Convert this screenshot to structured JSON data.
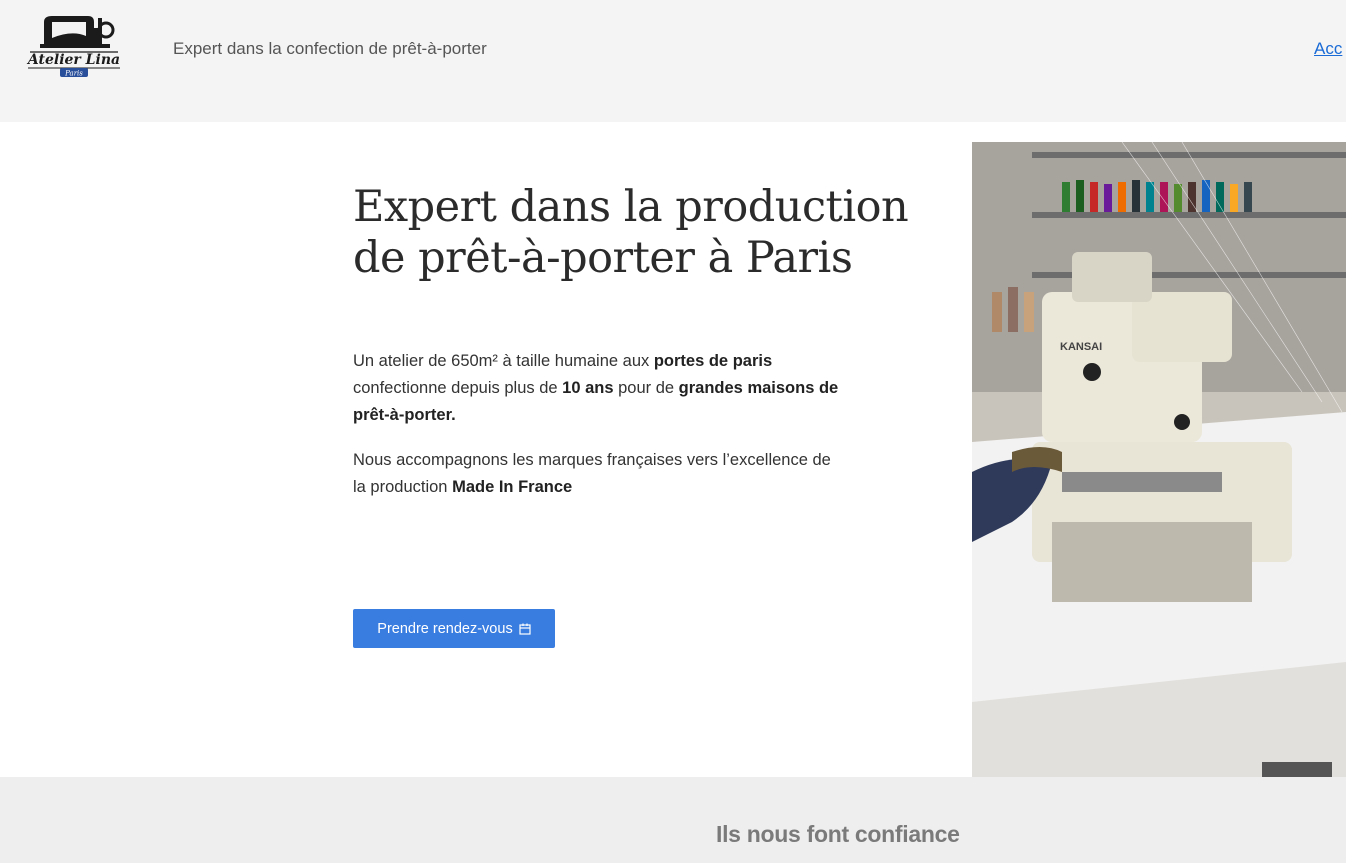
{
  "header": {
    "logo": {
      "brand": "Atelier Lina",
      "sub": "Paris"
    },
    "tagline": "Expert dans la confection de prêt-à-porter",
    "nav_link": "Acc"
  },
  "hero": {
    "title_line1": "Expert dans la production",
    "title_line2": "de prêt-à-porter à Paris",
    "p1": {
      "a": "Un atelier de 650m² à taille humaine aux ",
      "b": "portes de paris",
      "c": " confectionne depuis plus de ",
      "d": "10 ans",
      "e": " pour de ",
      "f": "grandes maisons de prêt-à-porter."
    },
    "p2": {
      "a": "Nous accompagnons les marques françaises vers l’excellence de la production ",
      "b": "Made In France"
    },
    "cta_label": "Prendre rendez-vous",
    "photo_label": "KANSAI"
  },
  "trust": {
    "title": "Ils nous font confiance"
  },
  "colors": {
    "accent": "#3a7de0",
    "header_bg": "#f4f4f4",
    "band_bg": "#eeeeee",
    "link": "#1a6bd6"
  },
  "icons": {
    "cta": "calendar-icon",
    "logo": "sewing-machine-icon"
  }
}
